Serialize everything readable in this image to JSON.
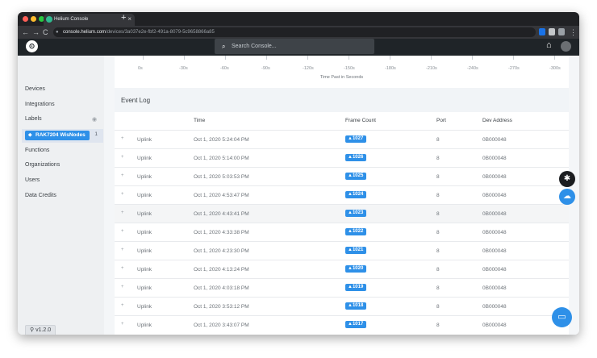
{
  "browser": {
    "tab_title": "Helium Console",
    "tab_close": "×",
    "new_tab": "+",
    "url_host": "console.helium.com",
    "url_path": "/devices/3a037e2e-fbf2-491a-8079-5c9658866a85",
    "back": "←",
    "forward": "→",
    "reload": "C"
  },
  "header": {
    "search_placeholder": "Search Console...",
    "search_icon": "⌕",
    "home_icon": "⌂",
    "logo": "⊙"
  },
  "sidebar": {
    "items": [
      {
        "label": "Devices"
      },
      {
        "label": "Integrations"
      },
      {
        "label": "Labels"
      },
      {
        "label": "Functions"
      },
      {
        "label": "Organizations"
      },
      {
        "label": "Users"
      },
      {
        "label": "Data Credits"
      }
    ],
    "active_label": "RAK7204 WisNodes",
    "active_label_count": "1",
    "label_visibility_icon": "◉",
    "version": "v1.2.0",
    "version_icon": "⚲"
  },
  "chart_data": {
    "type": "scatter",
    "x_ticks": [
      "0s",
      "-30s",
      "-60s",
      "-90s",
      "-120s",
      "-150s",
      "-180s",
      "-210s",
      "-240s",
      "-270s",
      "-300s"
    ],
    "xlabel": "Time Past in Seconds",
    "xlim": [
      0,
      -300
    ]
  },
  "event_log": {
    "title": "Event Log",
    "columns": {
      "time": "Time",
      "frame_count": "Frame Count",
      "port": "Port",
      "dev_address": "Dev Address"
    },
    "rows": [
      {
        "type": "Uplink",
        "time": "Oct 1, 2020 5:24:04 PM",
        "frame_count": "1027",
        "port": "8",
        "dev_address": "0B000048"
      },
      {
        "type": "Uplink",
        "time": "Oct 1, 2020 5:14:00 PM",
        "frame_count": "1026",
        "port": "8",
        "dev_address": "0B000048"
      },
      {
        "type": "Uplink",
        "time": "Oct 1, 2020 5:03:53 PM",
        "frame_count": "1025",
        "port": "8",
        "dev_address": "0B000048"
      },
      {
        "type": "Uplink",
        "time": "Oct 1, 2020 4:53:47 PM",
        "frame_count": "1024",
        "port": "8",
        "dev_address": "0B000048"
      },
      {
        "type": "Uplink",
        "time": "Oct 1, 2020 4:43:41 PM",
        "frame_count": "1023",
        "port": "8",
        "dev_address": "0B000048"
      },
      {
        "type": "Uplink",
        "time": "Oct 1, 2020 4:33:38 PM",
        "frame_count": "1022",
        "port": "8",
        "dev_address": "0B000048"
      },
      {
        "type": "Uplink",
        "time": "Oct 1, 2020 4:23:30 PM",
        "frame_count": "1021",
        "port": "8",
        "dev_address": "0B000048"
      },
      {
        "type": "Uplink",
        "time": "Oct 1, 2020 4:13:24 PM",
        "frame_count": "1020",
        "port": "8",
        "dev_address": "0B000048"
      },
      {
        "type": "Uplink",
        "time": "Oct 1, 2020 4:03:18 PM",
        "frame_count": "1019",
        "port": "8",
        "dev_address": "0B000048"
      },
      {
        "type": "Uplink",
        "time": "Oct 1, 2020 3:53:12 PM",
        "frame_count": "1018",
        "port": "8",
        "dev_address": "0B000048"
      },
      {
        "type": "Uplink",
        "time": "Oct 1, 2020 3:43:07 PM",
        "frame_count": "1017",
        "port": "8",
        "dev_address": "0B000048"
      }
    ]
  },
  "floating": {
    "debug_icon": "✱",
    "cloud_icon": "☁",
    "chat_icon": "▭"
  },
  "colors": {
    "accent": "#2e90e8",
    "header_bg": "#1f2428",
    "sidebar_bg": "#eef0f2"
  }
}
